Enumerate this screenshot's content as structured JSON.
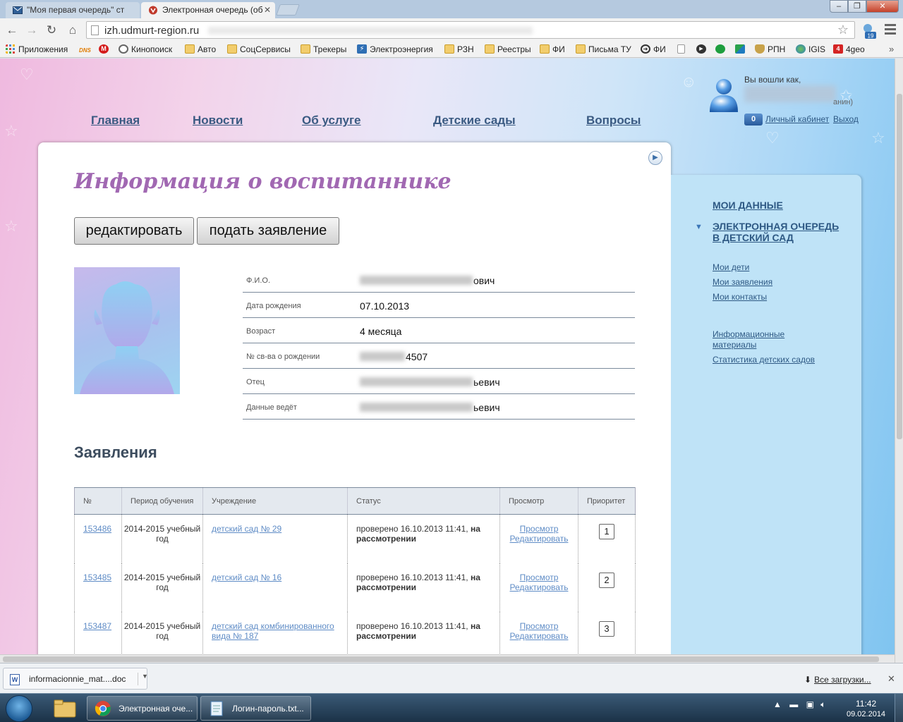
{
  "browser": {
    "tabs": [
      {
        "title": "\"Моя первая очередь\" ст"
      },
      {
        "title": "Электронная очередь (об"
      }
    ],
    "url": "izh.udmurt-region.ru",
    "ext_badge": "19",
    "bookmarks": [
      {
        "label": "Приложения",
        "icon": "apps-grid-icon"
      },
      {
        "label": "",
        "icon": "dns-icon",
        "short": "DNS"
      },
      {
        "label": "",
        "icon": "metro-icon"
      },
      {
        "label": "Кинопоиск",
        "icon": "film-reel-icon"
      },
      {
        "label": "Авто",
        "icon": "folder-icon"
      },
      {
        "label": "СоцСервисы",
        "icon": "folder-icon"
      },
      {
        "label": "Трекеры",
        "icon": "folder-icon"
      },
      {
        "label": "Электроэнергия",
        "icon": "bolt-icon"
      },
      {
        "label": "РЗН",
        "icon": "folder-icon"
      },
      {
        "label": "Реестры",
        "icon": "folder-icon"
      },
      {
        "label": "ФИ",
        "icon": "folder-icon"
      },
      {
        "label": "Письма ТУ",
        "icon": "folder-icon"
      },
      {
        "label": "ФИ",
        "icon": "arrow-circle-icon"
      },
      {
        "label": "",
        "icon": "page-icon"
      },
      {
        "label": "",
        "icon": "play-circle-icon"
      },
      {
        "label": "",
        "icon": "bank-leaf-icon"
      },
      {
        "label": "",
        "icon": "green-square-icon"
      },
      {
        "label": "РПН",
        "icon": "emblem-icon"
      },
      {
        "label": "IGIS",
        "icon": "globe-icon"
      },
      {
        "label": "4geo",
        "icon": "red-4-icon"
      }
    ],
    "more": "»"
  },
  "site": {
    "nav": [
      {
        "label": "Главная"
      },
      {
        "label": "Новости"
      },
      {
        "label": "Об услуге"
      },
      {
        "label": "Детские сады"
      },
      {
        "label": "Вопросы"
      }
    ],
    "login": {
      "label": "Вы вошли как,",
      "tail": "анин)",
      "badge": "0",
      "cabinet": "Личный кабинет",
      "logout": "Выход"
    }
  },
  "main": {
    "title": "Информация о воспитаннике",
    "buttons": {
      "edit": "редактировать",
      "apply": "подать заявление"
    },
    "info_rows": [
      {
        "label": "Ф.И.О.",
        "suffix": "ович"
      },
      {
        "label": "Дата рождения",
        "value": "07.10.2013"
      },
      {
        "label": "Возраст",
        "value": "4 месяца"
      },
      {
        "label": "№ св-ва о рождении",
        "suffix": "4507"
      },
      {
        "label": "Отец",
        "suffix": "ьевич"
      },
      {
        "label": "Данные ведёт",
        "suffix": "ьевич"
      }
    ],
    "applications_title": "Заявления",
    "table": {
      "headers": [
        "№",
        "Период обучения",
        "Учреждение",
        "Статус",
        "Просмотр",
        "Приоритет"
      ],
      "rows": [
        {
          "id": "153486",
          "period": "2014-2015 учебный год",
          "institution": "детский сад № 29",
          "status_prefix": "проверено 16.10.2013 11:41, ",
          "status_bold": "на рассмотрении",
          "view": "Просмотр",
          "edit": "Редактировать",
          "priority": "1"
        },
        {
          "id": "153485",
          "period": "2014-2015 учебный год",
          "institution": "детский сад № 16",
          "status_prefix": "проверено 16.10.2013 11:41, ",
          "status_bold": "на рассмотрении",
          "view": "Просмотр",
          "edit": "Редактировать",
          "priority": "2"
        },
        {
          "id": "153487",
          "period": "2014-2015 учебный год",
          "institution": "детский сад комбинированного вида № 187",
          "status_prefix": "проверено 16.10.2013 11:41, ",
          "status_bold": "на рассмотрении",
          "view": "Просмотр",
          "edit": "Редактировать",
          "priority": "3"
        }
      ]
    }
  },
  "sidebar": {
    "my_data": "МОИ ДАННЫЕ",
    "queue": "ЭЛЕКТРОННАЯ ОЧЕРЕДЬ В ДЕТСКИЙ САД",
    "links": [
      "Мои дети",
      "Мои заявления",
      "Мои контакты"
    ],
    "info_materials": "Информационные материалы",
    "stats": "Статистика детских садов"
  },
  "downloads": {
    "file": "informacionnie_mat....doc",
    "all": "Все загрузки..."
  },
  "taskbar": {
    "chrome": "Электронная оче...",
    "notepad": "Логин-пароль.txt...",
    "time": "11:42",
    "date": "09.02.2014"
  },
  "colors": {
    "title": "#a168b2",
    "nav_link": "#3a5a82",
    "table_link": "#5f8cc6",
    "sidebar_bg": "#bfe3f7"
  }
}
